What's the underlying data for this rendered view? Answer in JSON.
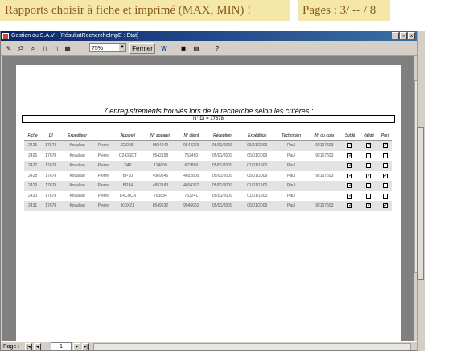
{
  "banner": {
    "left": "Rapports choisir à fiche et imprimé (MAX, MIN) !",
    "right": "Pages : 3/ -- / 8"
  },
  "window": {
    "title": "Gestion du S.A.V - [RésultatRechercheImpE : État]",
    "buttons": [
      "_",
      "▫",
      "×"
    ]
  },
  "toolbar": {
    "zoom": "75%",
    "close_label": "Fermer",
    "icon_w": "W"
  },
  "report": {
    "title": "7 enregistrements trouvés lors de la recherche selon les critères :",
    "di_line": "N° DI = 17678",
    "columns": [
      "Fiche",
      "DI",
      "Expéditeur",
      "",
      "Appareil",
      "N° appareil",
      "N° client",
      "Réception",
      "Expédition",
      "Technicien",
      "N° du colis",
      "Soldé",
      "Validé",
      "Parti"
    ],
    "rows": [
      {
        "fiche": "2425",
        "di": "17678",
        "exp1": "Kovalian",
        "exp2": "Pierre",
        "app": "C300SI",
        "napp": "0584042",
        "ncli": "0544223",
        "rec": "05/01/2009",
        "expd": "05/01/2009",
        "tech": "Paul",
        "colis": "92107693",
        "solde": true,
        "valide": true,
        "parti": true
      },
      {
        "fiche": "2426",
        "di": "17678",
        "exp1": "Kovalian",
        "exp2": "Pierre",
        "app": "C243SDT",
        "napp": "9542158",
        "ncli": "752450",
        "rec": "05/01/2009",
        "expd": "05/01/2009",
        "tech": "Paul",
        "colis": "92107693",
        "solde": true,
        "valide": false,
        "parti": false
      },
      {
        "fiche": "2427",
        "di": "17678",
        "exp1": "Kovalian",
        "exp2": "Pierre",
        "app": "D46",
        "napp": "124809",
        "ncli": "623869",
        "rec": "05/01/2009",
        "expd": "01/01/1900",
        "tech": "Paul",
        "colis": "",
        "solde": true,
        "valide": false,
        "parti": false
      },
      {
        "fiche": "2428",
        "di": "17678",
        "exp1": "Kovalian",
        "exp2": "Pierre",
        "app": "BP10",
        "napp": "4569545",
        "ncli": "4652809",
        "rec": "05/01/2009",
        "expd": "05/01/2009",
        "tech": "Paul",
        "colis": "92107693",
        "solde": true,
        "valide": true,
        "parti": true
      },
      {
        "fiche": "2429",
        "di": "17678",
        "exp1": "Kovalian",
        "exp2": "Pierre",
        "app": "BP34",
        "napp": "4852163",
        "ncli": "4654327",
        "rec": "05/01/2009",
        "expd": "01/01/1900",
        "tech": "Paul",
        "colis": "",
        "solde": true,
        "valide": false,
        "parti": false
      },
      {
        "fiche": "2430",
        "di": "17678",
        "exp1": "Kovalian",
        "exp2": "Pierre",
        "app": "K4CNCA",
        "napp": "763894",
        "ncli": "753241",
        "rec": "05/01/2009",
        "expd": "01/01/1900",
        "tech": "Paul",
        "colis": "",
        "solde": true,
        "valide": false,
        "parti": false
      },
      {
        "fiche": "2431",
        "di": "17678",
        "exp1": "Kovalian",
        "exp2": "Pierre",
        "app": "KDX21",
        "napp": "8549632",
        "ncli": "9546652",
        "rec": "05/01/2009",
        "expd": "05/01/2009",
        "tech": "Paul",
        "colis": "92107693",
        "solde": true,
        "valide": true,
        "parti": true
      }
    ]
  },
  "status": {
    "page_label": "Page :",
    "page_value": "1"
  }
}
